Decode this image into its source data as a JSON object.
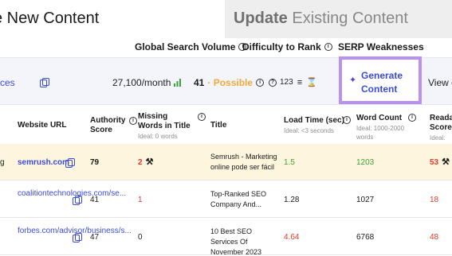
{
  "tabs": {
    "create_label": "e New Content",
    "update_bold": "Update",
    "update_rest": " Existing Content"
  },
  "metrics_header": {
    "volume": "Global Search Volume",
    "difficulty": "Difficulty to Rank",
    "serp": "SERP Weaknesses"
  },
  "summary": {
    "link_fragment": "ces",
    "volume_value": "27,100/month",
    "difficulty_value": "41",
    "difficulty_label": "· Possible",
    "serp_count": "123",
    "view_fragment": "View c"
  },
  "generate_button": {
    "label": "Generate Content"
  },
  "table": {
    "headers": {
      "website_url": "Website URL",
      "authority": "Authority Score",
      "missing_words": "Missing Words in Title",
      "missing_words_ideal": "Ideal: 0 words",
      "title": "Title",
      "load_time": "Load Time (sec)",
      "load_time_ideal": "Ideal: <3 seconds",
      "word_count": "Word Count",
      "word_count_ideal": "Ideal: 1000-2000 words",
      "readability": "Reada Score",
      "readability_ideal": "Ideal: 60"
    },
    "rows": [
      {
        "left_fragment": "g",
        "url": "semrush.com",
        "authority": "79",
        "missing": "2",
        "title": "Semrush - Marketing online pode ser fácil",
        "load": "1.5",
        "words": "1203",
        "readability": "53"
      },
      {
        "url": "coalitiontechnologies.com/se...",
        "authority": "41",
        "missing": "1",
        "title": "Top-Ranked SEO Company And...",
        "load": "1.28",
        "words": "1027",
        "readability": "18"
      },
      {
        "url": "forbes.com/advisor/business/s...",
        "authority": "47",
        "missing": "0",
        "title": "10 Best SEO Services Of November 2023",
        "load": "4.64",
        "words": "6768",
        "readability": "48"
      }
    ]
  },
  "colors": {
    "link": "#3b4bd9",
    "highlight_row": "#fef5de",
    "summary_bg": "#f4f5fb",
    "button_border": "#b892ee",
    "good": "#3aa33a",
    "bad": "#e5392b",
    "possible": "#f0a93b"
  }
}
